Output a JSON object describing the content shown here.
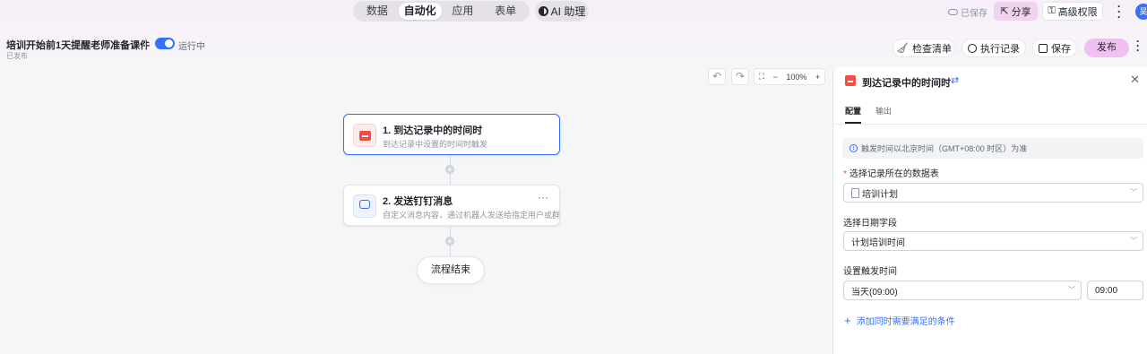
{
  "top_tabs": [
    "数据",
    "自动化",
    "应用",
    "表单"
  ],
  "active_tab": "自动化",
  "ai_assistant": "AI 助理",
  "saved_status": "已保存",
  "share_label": "分享",
  "permission_label": "高级权限",
  "avatar_text": "吴",
  "workflow": {
    "title": "培训开始前1天提醒老师准备课件",
    "run_status": "运行中",
    "publish_status": "已发布",
    "enabled": true
  },
  "toolbar": {
    "checklist": "检查清单",
    "run_log": "执行记录",
    "save": "保存",
    "publish": "发布"
  },
  "zoom": {
    "minus": "−",
    "level": "100%",
    "plus": "+"
  },
  "nodes": [
    {
      "title": "1. 到达记录中的时间时",
      "desc": "到达记录中设置的时间时触发"
    },
    {
      "title": "2. 发送钉钉消息",
      "desc": "自定义消息内容，通过机器人发送给指定用户或群"
    }
  ],
  "end_node": "流程结束",
  "panel": {
    "title": "到达记录中的时间时",
    "tabs": [
      "配置",
      "输出"
    ],
    "note": "触发时间以北京时间（GMT+08:00 时区）为准",
    "table_label": "选择记录所在的数据表",
    "table_value": "培训计划",
    "date_label": "选择日期字段",
    "date_value": "计划培训时间",
    "trigger_label": "设置触发时间",
    "trigger_day": "当天(09:00)",
    "trigger_time": "09:00",
    "add_condition": "添加同时需要满足的条件"
  },
  "colors": {
    "accent": "#3370ff",
    "publish_bg": "#f2bff2",
    "trigger_icon": "#f54a45"
  }
}
